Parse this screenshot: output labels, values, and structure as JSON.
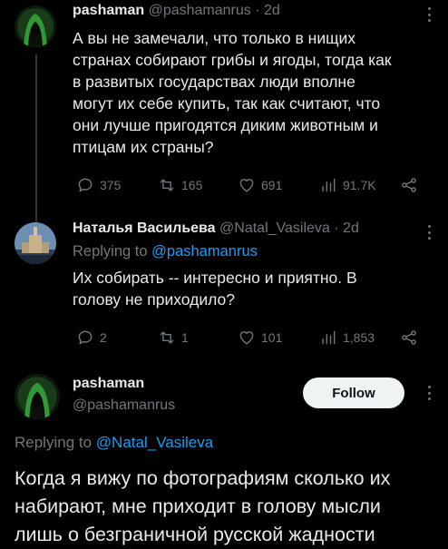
{
  "tweet1": {
    "name": "pashaman",
    "handle": "@pashamanrus",
    "time": "· 2d",
    "lines": [
      "А вы не замечали, что только в нищих",
      "странах собирают грибы и ягоды, тогда как",
      "в развитых государствах люди вполне",
      "могут их себе купить, так как считают, что",
      "они лучше пригодятся диким животным и",
      "птицам их страны?"
    ],
    "replies": "375",
    "retweets": "165",
    "likes": "691",
    "views": "91.7K"
  },
  "tweet2": {
    "name": "Наталья Васильева",
    "handle": "@Natal_Vasileva",
    "time": "· 2d",
    "replying_prefix": "Replying to ",
    "replying_handle": "@pashamanrus",
    "lines": [
      "Их собирать -- интересно и приятно. В",
      "голову не приходило?"
    ],
    "replies": "2",
    "retweets": "1",
    "likes": "101",
    "views": "1,853"
  },
  "tweet3": {
    "name": "pashaman",
    "handle": "@pashamanrus",
    "follow_label": "Follow",
    "replying_prefix": "Replying to ",
    "replying_handle": "@Natal_Vasileva",
    "lines": [
      "Когда я вижу по фотографиям сколько их",
      "набирают, мне приходит в голову мысли",
      "лишь о безграничной русской жадности"
    ]
  },
  "colors": {
    "background": "#000000",
    "text": "#e7e9ea",
    "secondary": "#71767b",
    "link": "#1d9bf0"
  }
}
